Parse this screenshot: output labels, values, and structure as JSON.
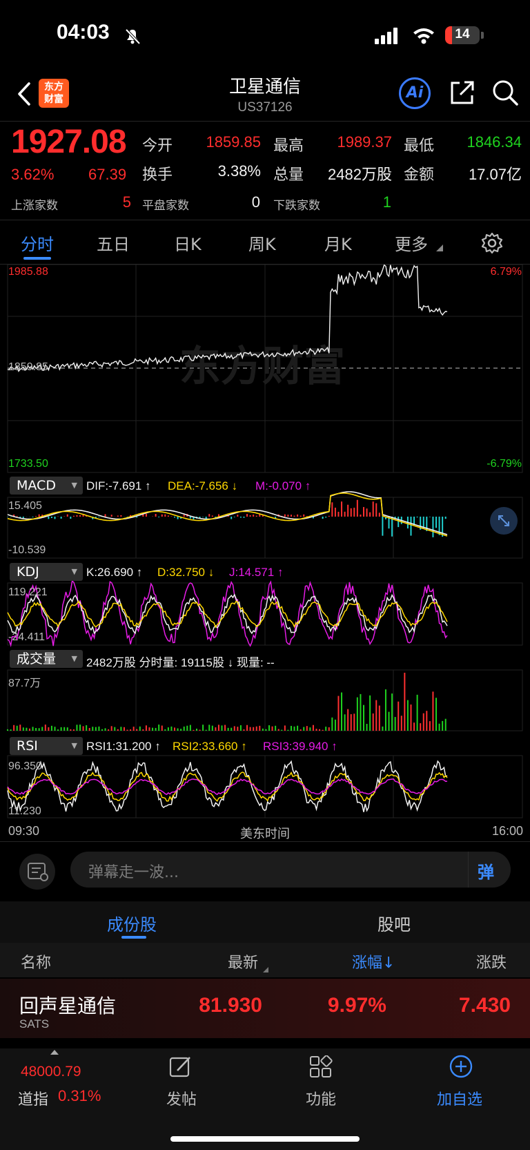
{
  "status": {
    "time": "04:03",
    "battery": "14"
  },
  "nav": {
    "title": "卫星通信",
    "code": "US37126",
    "logo_text_1": "东方",
    "logo_text_2": "财富",
    "ai_label": "Ai"
  },
  "quote": {
    "price": "1927.08",
    "change_pct": "3.62%",
    "change": "67.39",
    "open_label": "今开",
    "open": "1859.85",
    "high_label": "最高",
    "high": "1989.37",
    "low_label": "最低",
    "low": "1846.34",
    "turnover_label": "换手",
    "turnover": "3.38%",
    "volume_label": "总量",
    "volume": "2482万股",
    "amount_label": "金额",
    "amount": "17.07亿",
    "up_label": "上涨家数",
    "up": "5",
    "flat_label": "平盘家数",
    "flat": "0",
    "down_label": "下跌家数",
    "down": "1"
  },
  "tabs": [
    "分时",
    "五日",
    "日K",
    "周K",
    "月K",
    "更多"
  ],
  "chart": {
    "price_top": "1985.88",
    "price_mid": "1859.85",
    "price_bot": "1733.50",
    "pct_top": "6.79%",
    "pct_bot": "-6.79%",
    "watermark": "东方财富",
    "time_start": "09:30",
    "time_mid": "美东时间",
    "time_end": "16:00"
  },
  "macd": {
    "name": "MACD",
    "dif": "DIF:-7.691 ↑",
    "dea": "DEA:-7.656 ↓",
    "m": "M:-0.070 ↑",
    "top": "15.405",
    "bot": "-10.539"
  },
  "kdj": {
    "name": "KDJ",
    "k": "K:26.690 ↑",
    "d": "D:32.750 ↓",
    "j": "J:14.571 ↑",
    "top": "119.221",
    "bot": "-24.411"
  },
  "vol": {
    "name": "成交量",
    "info": "2482万股 分时量: 19115股 ↓ 现量: --",
    "top": "87.7万"
  },
  "rsi": {
    "name": "RSI",
    "r1": "RSI1:31.200 ↑",
    "r2": "RSI2:33.660 ↑",
    "r3": "RSI3:39.940 ↑",
    "top": "96.350",
    "bot": "11.230"
  },
  "comment": {
    "placeholder": "弹幕走一波...",
    "send": "弹"
  },
  "section_tabs": [
    "成份股",
    "股吧"
  ],
  "columns": [
    "名称",
    "最新",
    "涨幅↓",
    "涨跌"
  ],
  "rows": [
    {
      "name": "回声星通信",
      "code": "SATS",
      "price": "81.930",
      "pct": "9.97%",
      "chg": "7.430"
    }
  ],
  "bottom": {
    "index_value": "48000.79",
    "index_name": "道指",
    "index_pct": "0.31%",
    "post": "发帖",
    "func": "功能",
    "add": "加自选"
  },
  "colors": {
    "up": "#ff2d2d",
    "down": "#1fd31f",
    "accent": "#3b8bff"
  }
}
